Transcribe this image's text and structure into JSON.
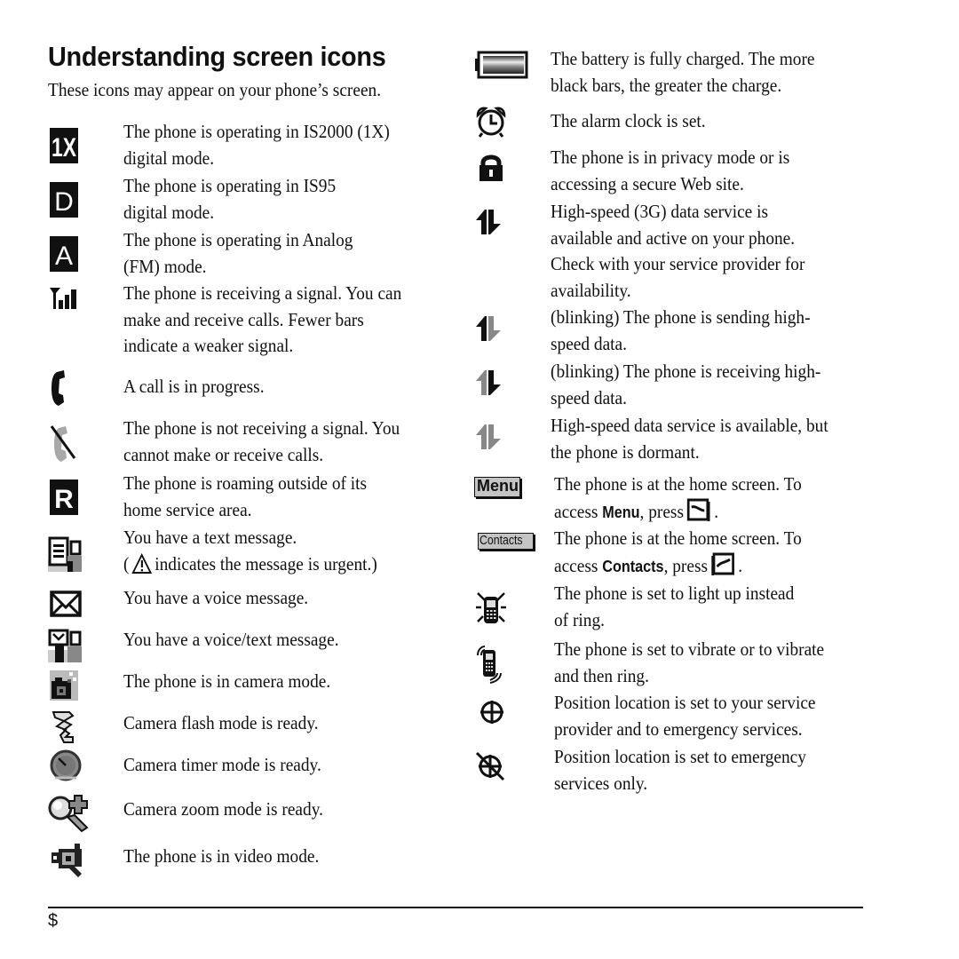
{
  "page": {
    "title": "Understanding screen icons",
    "intro": "These icons may appear on your phone’s screen.",
    "page_number": "$"
  },
  "left_column": [
    {
      "icon": "1x-mode-icon",
      "lines": [
        "The phone is operating in IS2000 (1X)",
        "digital mode."
      ]
    },
    {
      "icon": "d-mode-icon",
      "lines": [
        "The phone is operating in IS95",
        "digital mode."
      ]
    },
    {
      "icon": "analog-mode-icon",
      "lines": [
        "The phone is operating in Analog",
        "(FM) mode."
      ]
    },
    {
      "icon": "signal-strength-icon",
      "lines": [
        "The phone is receiving a signal. You can",
        "make and receive calls. Fewer bars",
        "indicate a weaker signal."
      ]
    },
    {
      "icon": "call-in-progress-icon",
      "lines": [
        "A call is in progress."
      ]
    },
    {
      "icon": "no-signal-icon",
      "lines": [
        "The phone is not receiving a signal. You",
        "cannot make or receive calls."
      ]
    },
    {
      "icon": "roaming-icon",
      "lines": [
        "The phone is roaming outside of its",
        "home service area."
      ]
    },
    {
      "icon": "text-message-icon",
      "lines": [
        "You have a text message."
      ],
      "note_open": "(",
      "note_icon": "warning-triangle-icon",
      "note_text": "indicates the message is urgent.)"
    },
    {
      "icon": "voice-message-icon",
      "lines": [
        "You have a voice message."
      ]
    },
    {
      "icon": "voice-text-message-icon",
      "lines": [
        "You have a voice/text message."
      ]
    },
    {
      "icon": "camera-mode-icon",
      "lines": [
        "The phone is in camera mode."
      ]
    },
    {
      "icon": "camera-flash-icon",
      "lines": [
        "Camera flash mode is ready."
      ]
    },
    {
      "icon": "camera-timer-icon",
      "lines": [
        "Camera timer mode is ready."
      ]
    },
    {
      "icon": "camera-zoom-icon",
      "lines": [
        "Camera zoom mode is ready."
      ]
    },
    {
      "icon": "video-mode-icon",
      "lines": [
        "The phone is in video mode."
      ]
    }
  ],
  "right_column": [
    {
      "icon": "battery-full-icon",
      "lines": [
        "The battery is fully charged. The more",
        "black bars, the greater the charge."
      ]
    },
    {
      "icon": "alarm-clock-icon",
      "lines": [
        "The alarm clock is set."
      ]
    },
    {
      "icon": "privacy-lock-icon",
      "lines": [
        "The phone is in privacy mode or is",
        "accessing a secure Web site."
      ]
    },
    {
      "icon": "data-active-icon",
      "lines": [
        "High-speed (3G) data service is",
        "available and active on your phone.",
        "Check with your service provider for",
        "availability."
      ]
    },
    {
      "icon": "data-sending-icon",
      "lines": [
        "(blinking) The phone is sending high-",
        "speed data."
      ]
    },
    {
      "icon": "data-receiving-icon",
      "lines": [
        "(blinking) The phone is receiving high-",
        "speed data."
      ]
    },
    {
      "icon": "data-dormant-icon",
      "lines": [
        "High-speed data service is available, but",
        "the phone is dormant."
      ]
    },
    {
      "icon": "menu-softkey-icon",
      "label": "Menu",
      "lines": [
        "The phone is at the home screen. To"
      ],
      "access_pre": "access ",
      "access_bold": "Menu",
      "access_post": ", press",
      "key_icon": "right-softkey-icon"
    },
    {
      "icon": "contacts-softkey-icon",
      "label": "Contacts",
      "lines": [
        "The phone is at the home screen. To"
      ],
      "access_pre": "access ",
      "access_bold": "Contacts",
      "access_post": ", press",
      "key_icon": "left-softkey-icon"
    },
    {
      "icon": "light-up-icon",
      "lines": [
        "The phone is set to light up instead",
        "of ring."
      ]
    },
    {
      "icon": "vibrate-icon",
      "lines": [
        "The phone is set to vibrate or to vibrate",
        "and then ring."
      ]
    },
    {
      "icon": "location-on-icon",
      "lines": [
        "Position location is set to your service",
        "provider and to emergency services."
      ]
    },
    {
      "icon": "location-e911-icon",
      "lines": [
        "Position location is set to emergency",
        "services only."
      ]
    }
  ]
}
